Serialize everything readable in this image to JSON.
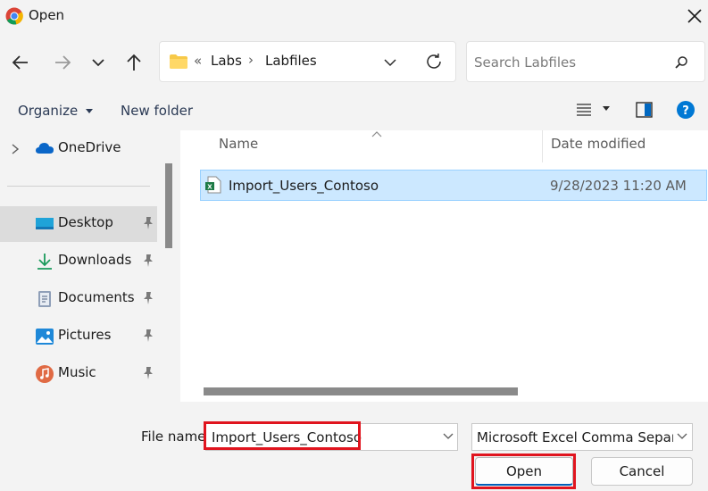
{
  "window": {
    "title": "Open"
  },
  "nav": {
    "breadcrumb_sep": "«",
    "path": [
      "Labs",
      "Labfiles"
    ],
    "path_arrow": "›"
  },
  "search": {
    "placeholder": "Search Labfiles"
  },
  "toolbar": {
    "organize_label": "Organize",
    "new_folder_label": "New folder"
  },
  "sidebar": {
    "items": [
      {
        "label": "OneDrive",
        "icon": "cloud-icon"
      },
      {
        "label": "Desktop",
        "icon": "desktop-icon",
        "pinned": true,
        "selected": true
      },
      {
        "label": "Downloads",
        "icon": "download-icon",
        "pinned": true
      },
      {
        "label": "Documents",
        "icon": "document-icon",
        "pinned": true
      },
      {
        "label": "Pictures",
        "icon": "picture-icon",
        "pinned": true
      },
      {
        "label": "Music",
        "icon": "music-icon",
        "pinned": true
      }
    ]
  },
  "files": {
    "columns": [
      "Name",
      "Date modified"
    ],
    "rows": [
      {
        "name": "Import_Users_Contoso",
        "date": "9/28/2023 11:20 AM",
        "icon": "excel-csv-icon"
      }
    ]
  },
  "footer": {
    "file_name_label": "File name:",
    "file_name_value": "Import_Users_Contoso",
    "file_type_value": "Microsoft Excel Comma Separated",
    "open_label": "Open",
    "cancel_label": "Cancel"
  },
  "colors": {
    "accent": "#0067c0",
    "highlight": "#e0141e",
    "selection": "#cce8ff"
  }
}
